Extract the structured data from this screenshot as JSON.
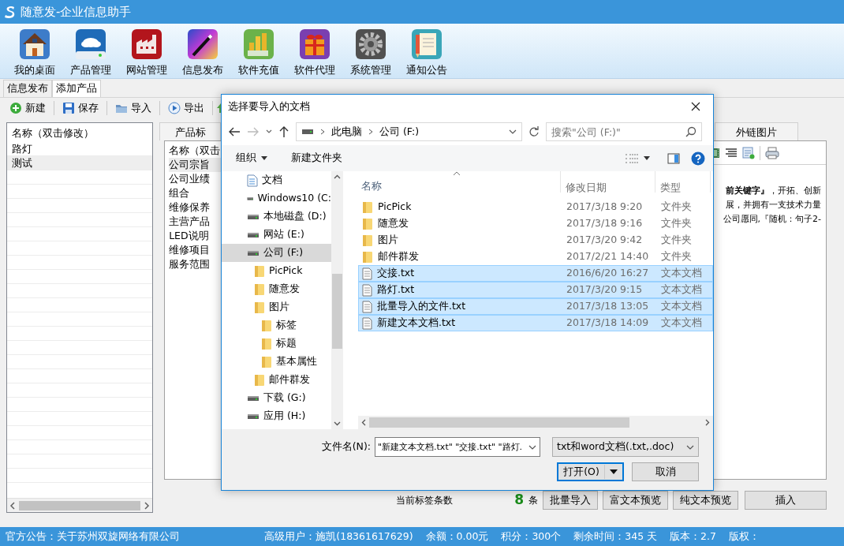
{
  "window": {
    "title": "随意发-企业信息助手"
  },
  "main_toolbar": [
    {
      "label": "我的桌面"
    },
    {
      "label": "产品管理"
    },
    {
      "label": "网站管理"
    },
    {
      "label": "信息发布"
    },
    {
      "label": "软件充值"
    },
    {
      "label": "软件代理"
    },
    {
      "label": "系统管理"
    },
    {
      "label": "通知公告"
    }
  ],
  "tabs": [
    {
      "label": "信息发布",
      "selected": false
    },
    {
      "label": "添加产品",
      "selected": true
    }
  ],
  "toolbar": [
    {
      "label": "新建"
    },
    {
      "label": "保存"
    },
    {
      "label": "导入"
    },
    {
      "label": "导出"
    }
  ],
  "category_list": {
    "header": "名称（双击修改）",
    "rows": [
      {
        "label": "路灯",
        "selected": false
      },
      {
        "label": "测试",
        "selected": true
      }
    ]
  },
  "inner_tabs": [
    {
      "label": "产品标"
    },
    {
      "label": "外链图片"
    }
  ],
  "tag_list": {
    "header": "名称（双击",
    "rows": [
      {
        "label": "公司宗旨",
        "selected": true
      },
      {
        "label": "公司业绩",
        "selected": false
      },
      {
        "label": "组合",
        "selected": false
      },
      {
        "label": "维修保养",
        "selected": false
      },
      {
        "label": "主营产品",
        "selected": false
      },
      {
        "label": "LED说明",
        "selected": false
      },
      {
        "label": "维修项目",
        "selected": false
      },
      {
        "label": "服务范围",
        "selected": false
      }
    ]
  },
  "editor_lines": [
    "**前关键字』**，开拓、创新",
    "展，并拥有一支技术力量",
    "公司愿同,『随机：句子2-"
  ],
  "footer": {
    "count_label": "当前标签条数",
    "count": "8",
    "unit": "条",
    "buttons": [
      "批量导入",
      "富文本预览",
      "纯文本预览",
      "插入"
    ]
  },
  "status_bar": {
    "notice": "官方公告：关于苏州双旋网络有限公司",
    "items": [
      "高级用户：施凯(18361617629)",
      "余额：0.00元",
      "积分：300个",
      "剩余时间：345 天",
      "版本：2.7",
      "版权："
    ]
  },
  "dialog": {
    "title": "选择要导入的文档",
    "breadcrumb": [
      "此电脑",
      "公司 (F:)"
    ],
    "search": {
      "placeholder": "搜索\"公司 (F:)\""
    },
    "toolbar": [
      {
        "label": "组织",
        "kind": "menu"
      },
      {
        "label": "新建文件夹",
        "kind": "button"
      }
    ],
    "tree": [
      {
        "label": "文档",
        "kind": "document",
        "selected": false
      },
      {
        "label": "Windows10 (C:",
        "kind": "drive",
        "selected": false
      },
      {
        "label": "本地磁盘 (D:)",
        "kind": "drive",
        "selected": false
      },
      {
        "label": "网站 (E:)",
        "kind": "drive",
        "selected": false
      },
      {
        "label": "公司 (F:)",
        "kind": "drive",
        "selected": true,
        "children": [
          {
            "label": "PicPick",
            "kind": "folder",
            "selected": false
          },
          {
            "label": "随意发",
            "kind": "folder",
            "selected": false
          },
          {
            "label": "图片",
            "kind": "folder",
            "selected": false,
            "children": [
              {
                "label": "标签",
                "kind": "folder",
                "selected": false
              },
              {
                "label": "标题",
                "kind": "folder",
                "selected": false
              },
              {
                "label": "基本属性",
                "kind": "folder",
                "selected": false
              }
            ]
          },
          {
            "label": "邮件群发",
            "kind": "folder",
            "selected": false
          }
        ]
      },
      {
        "label": "下载 (G:)",
        "kind": "drive",
        "selected": false
      },
      {
        "label": "应用 (H:)",
        "kind": "drive",
        "selected": false
      }
    ],
    "columns": [
      "名称",
      "修改日期",
      "类型"
    ],
    "files": [
      {
        "name": "PicPick",
        "date": "2017/3/18 9:20",
        "type": "文件夹",
        "kind": "folder",
        "selected": false
      },
      {
        "name": "随意发",
        "date": "2017/3/18 9:16",
        "type": "文件夹",
        "kind": "folder",
        "selected": false
      },
      {
        "name": "图片",
        "date": "2017/3/20 9:42",
        "type": "文件夹",
        "kind": "folder",
        "selected": false
      },
      {
        "name": "邮件群发",
        "date": "2017/2/21 14:40",
        "type": "文件夹",
        "kind": "folder",
        "selected": false
      },
      {
        "name": "交接.txt",
        "date": "2016/6/20 16:27",
        "type": "文本文档",
        "kind": "text",
        "selected": true
      },
      {
        "name": "路灯.txt",
        "date": "2017/3/20 9:15",
        "type": "文本文档",
        "kind": "text",
        "selected": true
      },
      {
        "name": "批量导入的文件.txt",
        "date": "2017/3/18 13:05",
        "type": "文本文档",
        "kind": "text",
        "selected": true
      },
      {
        "name": "新建文本文档.txt",
        "date": "2017/3/18 14:09",
        "type": "文本文档",
        "kind": "text",
        "selected": true
      }
    ],
    "filename": {
      "label": "文件名(N):",
      "value": "\"新建文本文档.txt\" \"交接.txt\" \"路灯."
    },
    "filetype": "txt和word文档(.txt,.doc)",
    "buttons": [
      {
        "label": "打开(O)",
        "kind": "split"
      },
      {
        "label": "取消",
        "kind": "plain"
      }
    ]
  }
}
